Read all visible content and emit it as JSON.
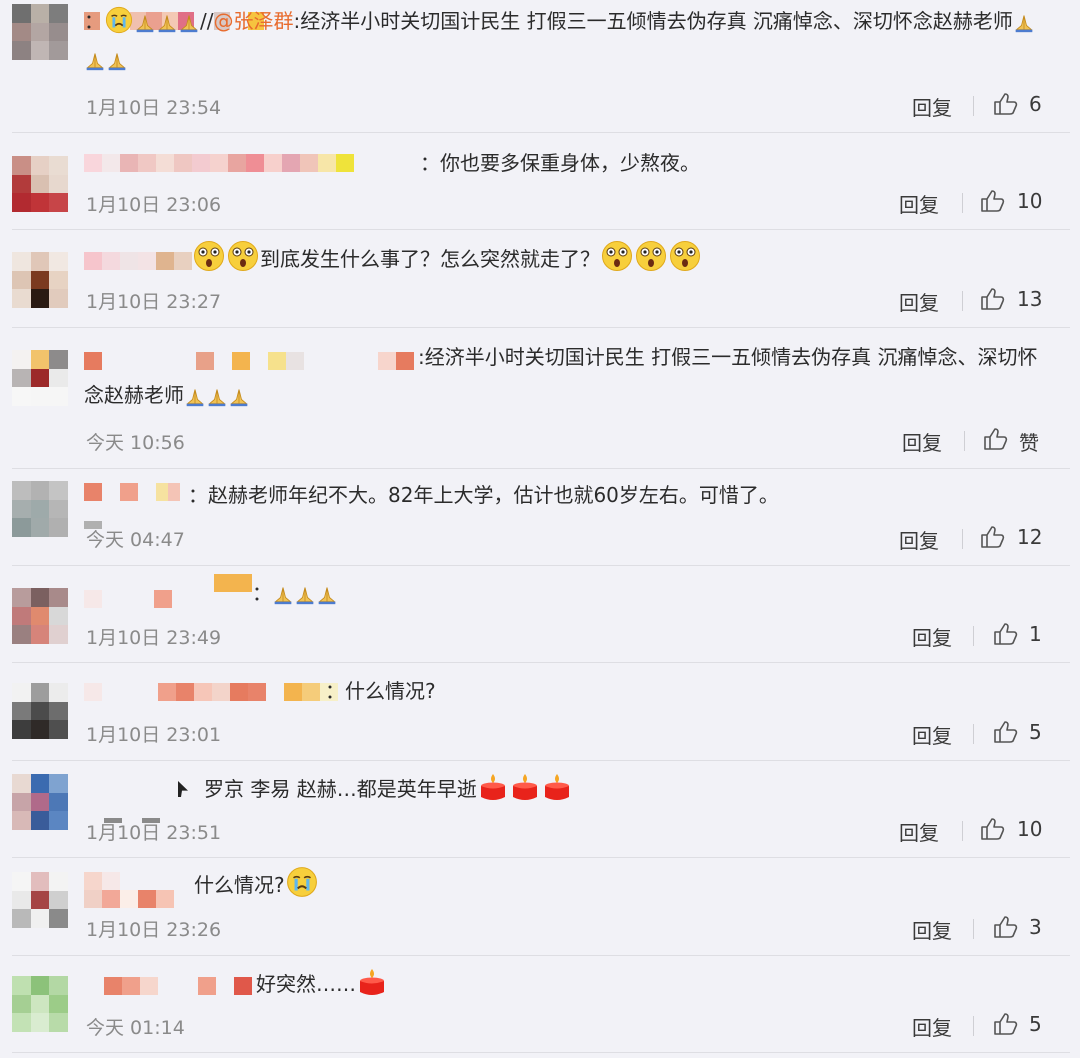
{
  "comments": [
    {
      "text_prefix": "：",
      "mention": "@张泽群",
      "text": ":经济半小时关切国计民生 打假三一五倾情去伪存真 沉痛悼念、深切怀念赵赫老师",
      "time": "1月10日 23:54",
      "reply": "回复",
      "likes": "6"
    },
    {
      "text": "：你也要多保重身体，少熬夜。",
      "time": "1月10日 23:06",
      "reply": "回复",
      "likes": "10"
    },
    {
      "text": "到底发生什么事了？怎么突然就走了？",
      "time": "1月10日 23:27",
      "reply": "回复",
      "likes": "13"
    },
    {
      "text": ":经济半小时关切国计民生 打假三一五倾情去伪存真 沉痛悼念、深切怀念赵赫老师",
      "time": "今天 10:56",
      "reply": "回复",
      "likes": "赞"
    },
    {
      "text": "：赵赫老师年纪不大。82年上大学，估计也就60岁左右。可惜了。",
      "time": "今天 04:47",
      "reply": "回复",
      "likes": "12"
    },
    {
      "text": "：",
      "time": "1月10日 23:49",
      "reply": "回复",
      "likes": "1"
    },
    {
      "text": "：什么情况?",
      "time": "1月10日 23:01",
      "reply": "回复",
      "likes": "5"
    },
    {
      "text": "罗京 李易 赵赫…都是英年早逝",
      "time": "1月10日 23:51",
      "reply": "回复",
      "likes": "10"
    },
    {
      "text": "什么情况?",
      "time": "1月10日 23:26",
      "reply": "回复",
      "likes": "3"
    },
    {
      "text": "好突然……",
      "time": "今天 01:14",
      "reply": "回复",
      "likes": "5"
    }
  ],
  "icons": {
    "like": "thumbs-up-icon",
    "crying": "crying-face-icon",
    "pray": "praying-hands-icon",
    "shocked": "shocked-face-icon",
    "candle": "candle-icon"
  },
  "colors": {
    "mention": "#e86b2d",
    "background": "#f2f2f7"
  }
}
